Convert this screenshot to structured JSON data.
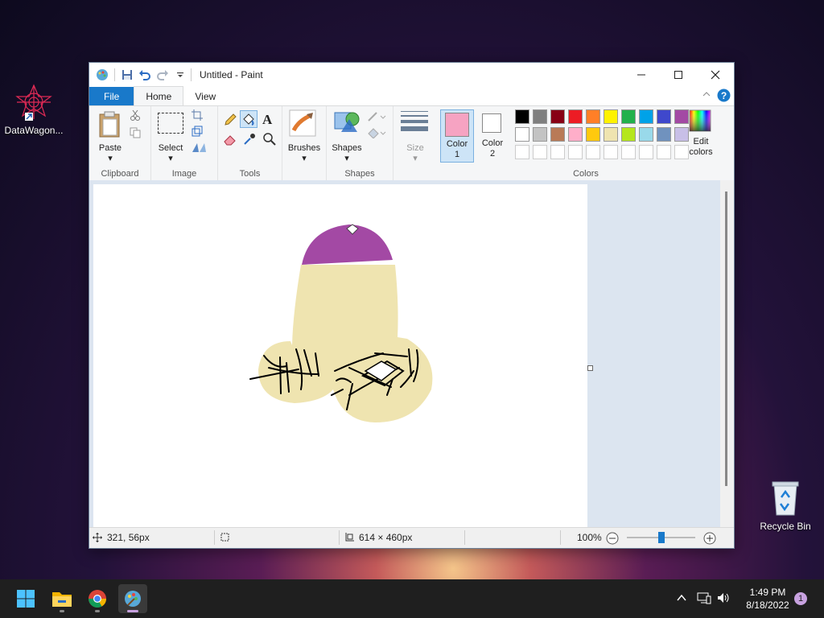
{
  "desktop": {
    "icons": [
      {
        "label": "DataWagon..."
      },
      {
        "label": "Recycle Bin"
      }
    ]
  },
  "window": {
    "title": "Untitled - Paint",
    "tabs": [
      "File",
      "Home",
      "View"
    ],
    "ribbon": {
      "clipboard": {
        "paste": "Paste",
        "label": "Clipboard"
      },
      "image": {
        "select": "Select",
        "label": "Image"
      },
      "tools": {
        "label": "Tools",
        "text_tool": "A"
      },
      "brushes": "Brushes",
      "shapes": {
        "shapes": "Shapes",
        "label": "Shapes"
      },
      "size": "Size",
      "colors": {
        "color1": "Color\n1",
        "color1_value": "#f6a3c2",
        "color2": "Color\n2",
        "color2_value": "#ffffff",
        "edit": "Edit colors",
        "label": "Colors",
        "palette_row1": [
          "#000000",
          "#7f7f7f",
          "#880015",
          "#ed1c24",
          "#ff7f27",
          "#fff200",
          "#22b14c",
          "#00a2e8",
          "#3f48cc",
          "#a349a4"
        ],
        "palette_row2": [
          "#ffffff",
          "#c3c3c3",
          "#b97a57",
          "#ffaec9",
          "#ffc90e",
          "#efe4b0",
          "#b5e61d",
          "#99d9ea",
          "#7092be",
          "#c8bfe7"
        ]
      }
    },
    "status": {
      "cursor": "321, 56px",
      "image_size": "614 × 460px",
      "zoom": "100%",
      "zoom_fraction": 0.5
    }
  },
  "taskbar": {
    "time": "1:49 PM",
    "date": "8/18/2022",
    "notification_count": "1"
  }
}
